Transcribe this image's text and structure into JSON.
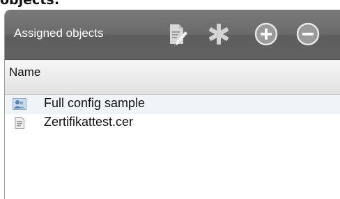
{
  "section": {
    "heading": "objects:"
  },
  "panel": {
    "title": "Assigned objects",
    "tools": [
      {
        "icon": "edit-document-icon"
      },
      {
        "icon": "asterisk-icon"
      },
      {
        "icon": "plus-circle-icon"
      },
      {
        "icon": "minus-circle-icon"
      }
    ],
    "column_header": "Name",
    "rows": [
      {
        "label": "Full config sample",
        "icon": "user-group-icon",
        "selected": true
      },
      {
        "label": "Zertifikattest.cer",
        "icon": "certificate-file-icon",
        "selected": false
      }
    ]
  },
  "colors": {
    "header_bg": "#6a6a6a",
    "title_text": "#ffffff",
    "selected_row_bg": "#f0f3f7"
  }
}
